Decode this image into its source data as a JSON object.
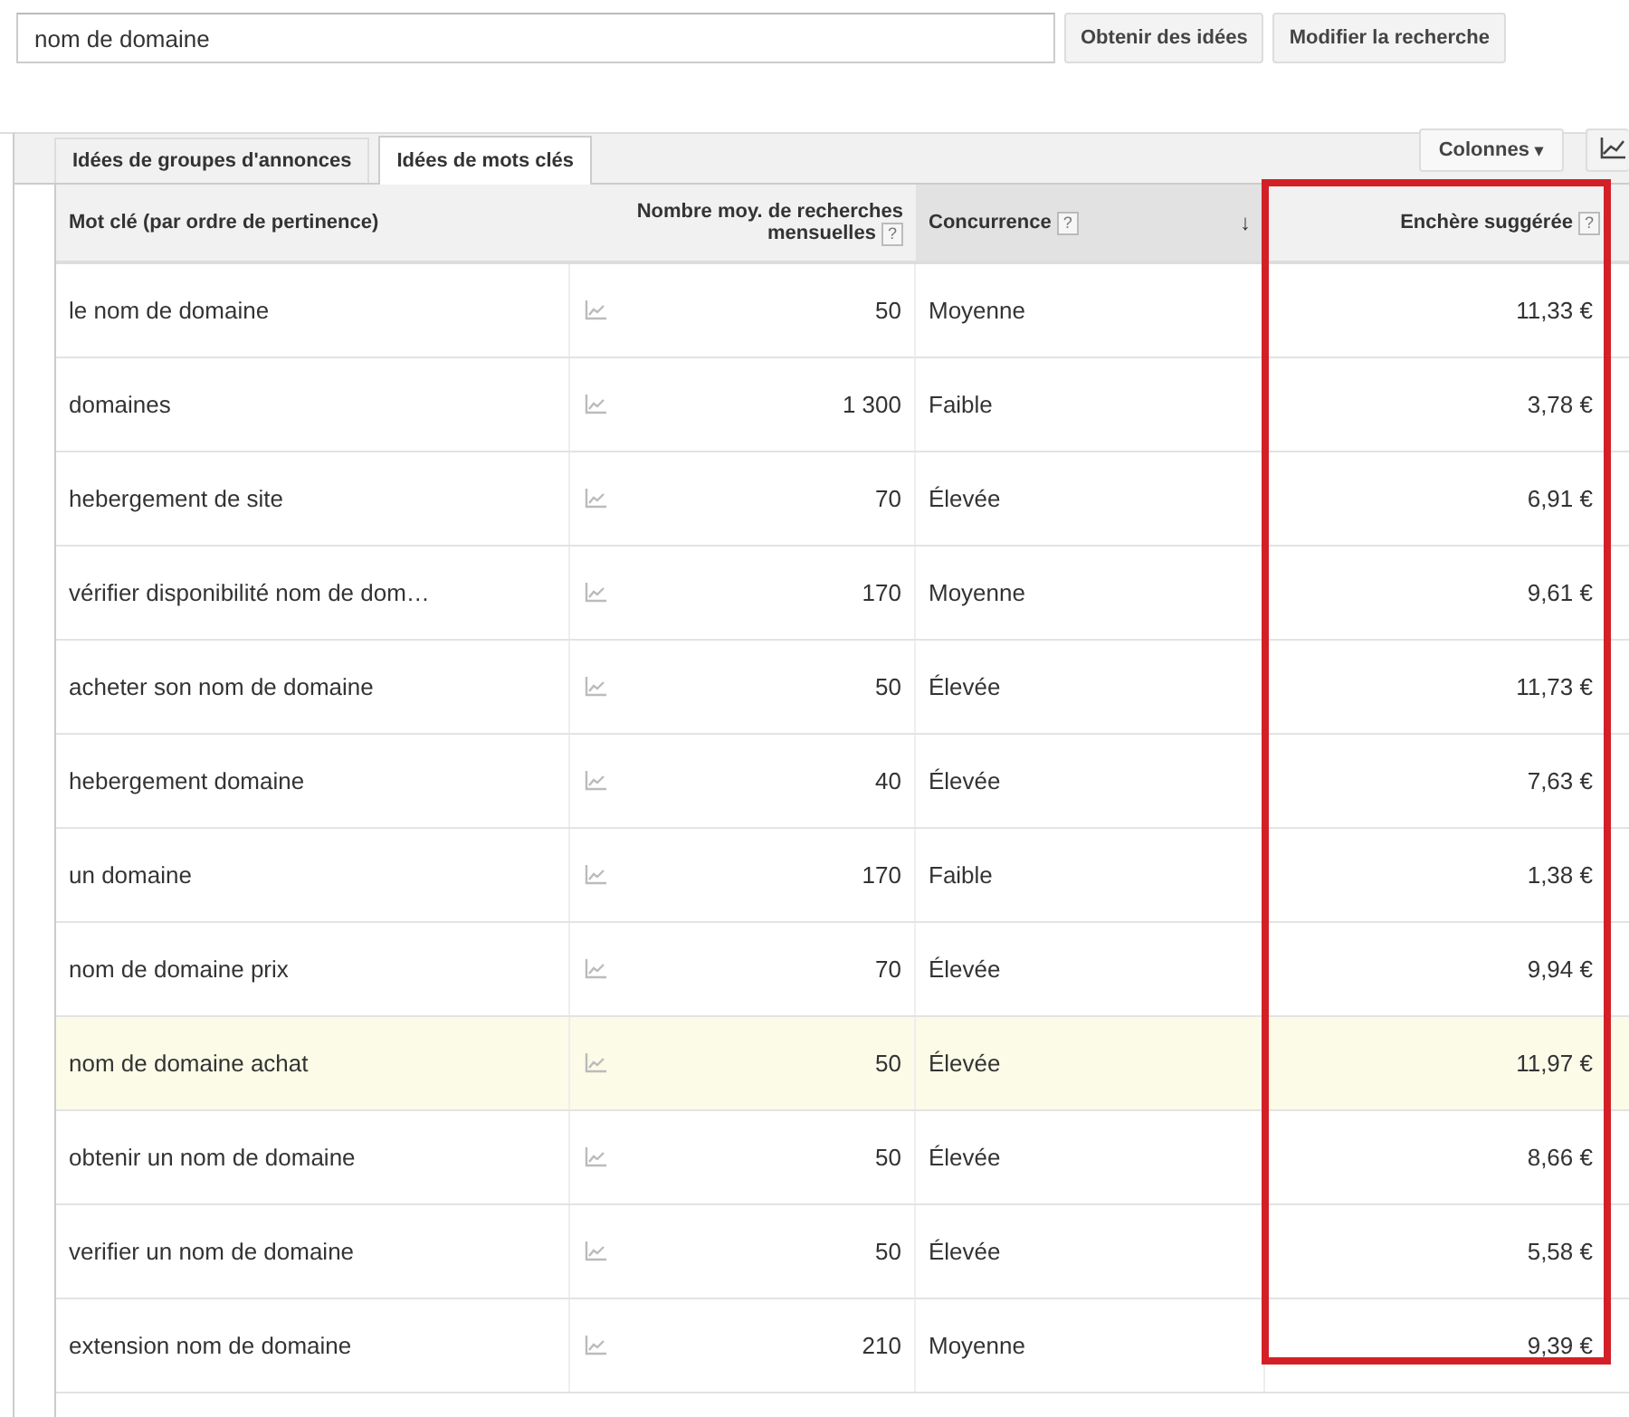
{
  "search": {
    "value": "nom de domaine"
  },
  "buttons": [
    "Obtenir des idées",
    "Modifier la recherche"
  ],
  "tabs": [
    {
      "label": "Idées de groupes d'annonces",
      "selected": false
    },
    {
      "label": "Idées de mots clés",
      "selected": true
    }
  ],
  "columns_button": {
    "label": "Colonnes",
    "caret": "▾"
  },
  "table": {
    "columns": [
      {
        "label": "Mot clé (par ordre de pertinence)",
        "outlined": false
      },
      {
        "label": "Nombre moy. de recherches mensuelles",
        "help": "?",
        "outlined": false
      },
      {
        "label": "Concurrence",
        "help": "?",
        "sort_mark": "↓",
        "outlined": false
      },
      {
        "label": "Enchère suggérée",
        "help": "?",
        "outlined": true
      }
    ],
    "rows": [
      {
        "keyword": "le nom de domaine",
        "searches": "50",
        "competition": "Moyenne",
        "bid": "11,33 €",
        "selected": false
      },
      {
        "keyword": "domaines",
        "searches": "1 300",
        "competition": "Faible",
        "bid": "3,78 €",
        "selected": false
      },
      {
        "keyword": "hebergement de site",
        "searches": "70",
        "competition": "Élevée",
        "bid": "6,91 €",
        "selected": false
      },
      {
        "keyword": "vérifier disponibilité nom de dom…",
        "searches": "170",
        "competition": "Moyenne",
        "bid": "9,61 €",
        "selected": false
      },
      {
        "keyword": "acheter son nom de domaine",
        "searches": "50",
        "competition": "Élevée",
        "bid": "11,73 €",
        "selected": false
      },
      {
        "keyword": "hebergement domaine",
        "searches": "40",
        "competition": "Élevée",
        "bid": "7,63 €",
        "selected": false
      },
      {
        "keyword": "un domaine",
        "searches": "170",
        "competition": "Faible",
        "bid": "1,38 €",
        "selected": false
      },
      {
        "keyword": "nom de domaine prix",
        "searches": "70",
        "competition": "Élevée",
        "bid": "9,94 €",
        "selected": false
      },
      {
        "keyword": "nom de domaine achat",
        "searches": "50",
        "competition": "Élevée",
        "bid": "11,97 €",
        "selected": true
      },
      {
        "keyword": "obtenir un nom de domaine",
        "searches": "50",
        "competition": "Élevée",
        "bid": "8,66 €",
        "selected": false
      },
      {
        "keyword": "verifier un nom de domaine",
        "searches": "50",
        "competition": "Élevée",
        "bid": "5,58 €",
        "selected": false
      },
      {
        "keyword": "extension nom de domaine",
        "searches": "210",
        "competition": "Moyenne",
        "bid": "9,39 €",
        "selected": false
      }
    ]
  }
}
